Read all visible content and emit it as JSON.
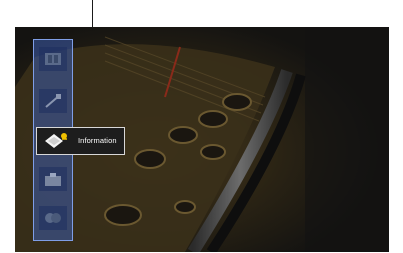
{
  "menu": {
    "items": [
      {
        "name": "scene-icon"
      },
      {
        "name": "speaker-settings-icon"
      },
      {
        "name": "information-icon",
        "label": "Information",
        "selected": true
      },
      {
        "name": "setup-icon"
      },
      {
        "name": "network-icon"
      }
    ]
  },
  "colors": {
    "menu_bg": "#3c5caf",
    "menu_border": "#7f9ee6",
    "screen_bg": "#181716",
    "badge": "#f0c000"
  }
}
